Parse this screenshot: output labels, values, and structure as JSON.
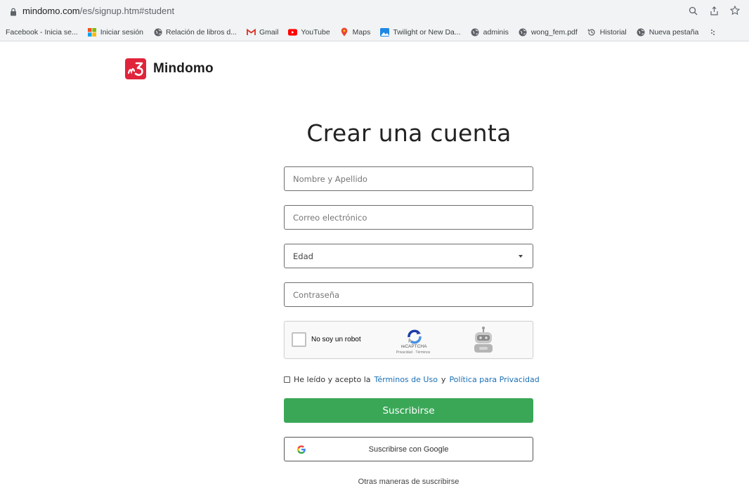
{
  "browser": {
    "url_domain": "mindomo.com",
    "url_path": "/es/signup.htm#student",
    "bookmarks": [
      {
        "label": "Facebook - Inicia se...",
        "icon": "none"
      },
      {
        "label": "Iniciar sesión",
        "icon": "microsoft-icon"
      },
      {
        "label": "Relación de libros d...",
        "icon": "globe-icon"
      },
      {
        "label": "Gmail",
        "icon": "gmail-icon"
      },
      {
        "label": "YouTube",
        "icon": "youtube-icon"
      },
      {
        "label": "Maps",
        "icon": "maps-icon"
      },
      {
        "label": "Twilight or New Da...",
        "icon": "image-icon"
      },
      {
        "label": "adminis",
        "icon": "globe-icon"
      },
      {
        "label": "wong_fem.pdf",
        "icon": "globe-icon"
      },
      {
        "label": "Historial",
        "icon": "history-icon"
      },
      {
        "label": "Nueva pestaña",
        "icon": "globe-icon"
      }
    ]
  },
  "brand": {
    "name": "Mindomo",
    "color": "#e0243b"
  },
  "form": {
    "title": "Crear una cuenta",
    "name_placeholder": "Nombre y Apellido",
    "email_placeholder": "Correo electrónico",
    "age_selected": "Edad",
    "password_placeholder": "Contraseña",
    "captcha_label": "No soy un robot",
    "captcha_brand": "reCAPTCHA",
    "captcha_links": "Privacidad · Términos",
    "terms_prefix": "He leído y acepto la",
    "terms_link": "Términos de Uso",
    "terms_and": "y",
    "privacy_link": "Política para Privacidad",
    "subscribe_label": "Suscribirse",
    "google_label": "Suscribirse con Google",
    "other_label": "Otras maneras de suscribirse"
  },
  "colors": {
    "primary_green": "#3aa757",
    "link_blue": "#1a6fb5"
  }
}
